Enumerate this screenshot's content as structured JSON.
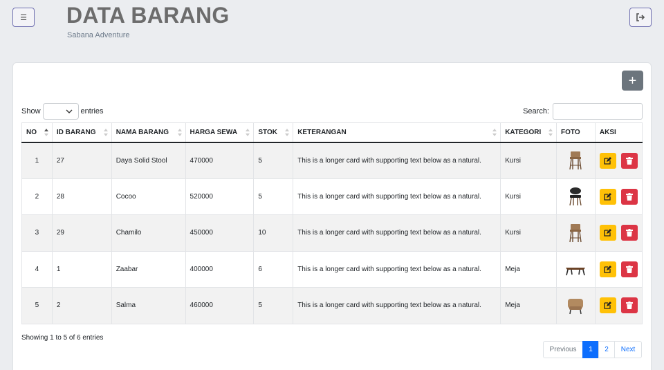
{
  "header": {
    "title": "DATA BARANG",
    "subtitle": "Sabana Adventure",
    "menu_icon": "hamburger-icon",
    "logout_icon": "sign-out-icon"
  },
  "toolbar": {
    "add_icon": "plus-icon",
    "add_symbol": "+"
  },
  "length": {
    "show_label": "Show",
    "entries_label": "entries",
    "selected": ""
  },
  "search": {
    "label": "Search:",
    "value": ""
  },
  "columns": [
    "NO",
    "ID BARANG",
    "NAMA BARANG",
    "HARGA SEWA",
    "STOK",
    "KETERANGAN",
    "KATEGORI",
    "FOTO",
    "AKSI"
  ],
  "rows": [
    {
      "no": "1",
      "id": "27",
      "nama": "Daya Solid Stool",
      "harga": "470000",
      "stok": "5",
      "keterangan": "This is a longer card with supporting text below as a natural.",
      "kategori": "Kursi",
      "foto": "bar-stool"
    },
    {
      "no": "2",
      "id": "28",
      "nama": "Cocoo",
      "harga": "520000",
      "stok": "5",
      "keterangan": "This is a longer card with supporting text below as a natural.",
      "kategori": "Kursi",
      "foto": "black-chair"
    },
    {
      "no": "3",
      "id": "29",
      "nama": "Chamilo",
      "harga": "450000",
      "stok": "10",
      "keterangan": "This is a longer card with supporting text below as a natural.",
      "kategori": "Kursi",
      "foto": "bar-stool"
    },
    {
      "no": "4",
      "id": "1",
      "nama": "Zaabar",
      "harga": "400000",
      "stok": "6",
      "keterangan": "This is a longer card with supporting text below as a natural.",
      "kategori": "Meja",
      "foto": "low-table"
    },
    {
      "no": "5",
      "id": "2",
      "nama": "Salma",
      "harga": "460000",
      "stok": "5",
      "keterangan": "This is a longer card with supporting text below as a natural.",
      "kategori": "Meja",
      "foto": "armchair"
    }
  ],
  "footer": {
    "info": "Showing 1 to 5 of 6 entries",
    "pagination": {
      "previous": "Previous",
      "pages": [
        "1",
        "2"
      ],
      "active": "1",
      "next": "Next"
    }
  },
  "colors": {
    "edit": "#ffc107",
    "delete": "#dc3545",
    "primary": "#0d6efd",
    "add": "#6c757d"
  }
}
